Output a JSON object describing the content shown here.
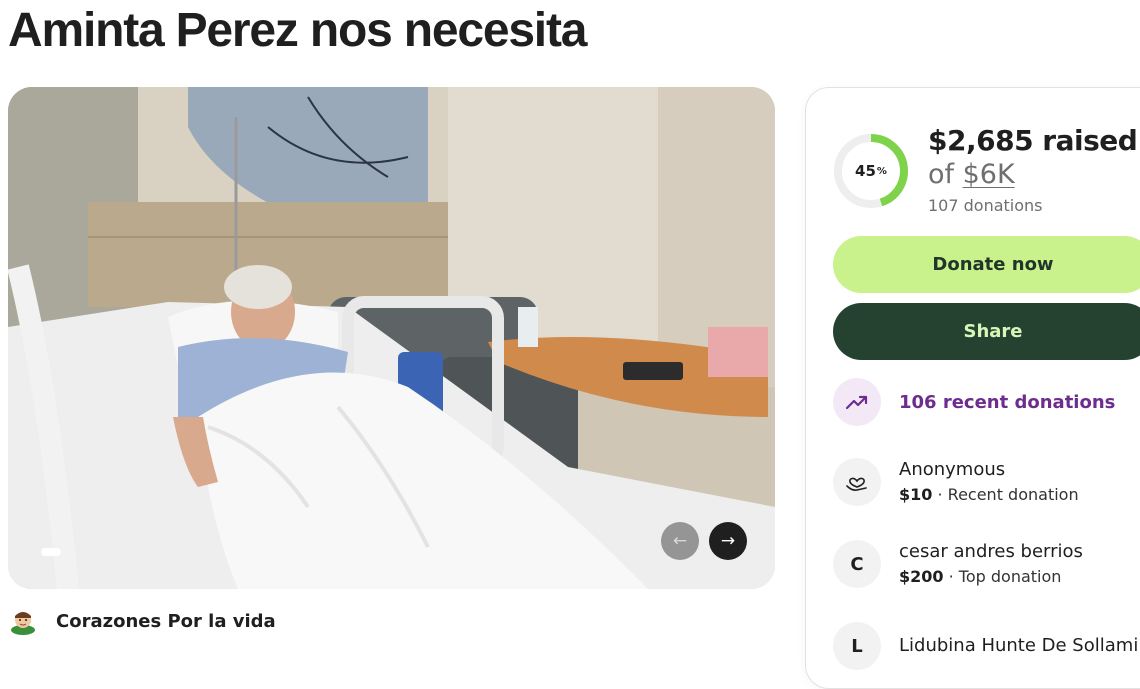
{
  "page": {
    "title": "Aminta Perez nos necesita"
  },
  "gallery": {
    "image_alt": "hospital-patient-photo"
  },
  "organizer": {
    "name": "Corazones Por la vida"
  },
  "donation_card": {
    "progress_percent": 45,
    "progress_label": "45",
    "progress_suffix": "%",
    "raised_text": "$2,685 raised",
    "goal_prefix": "of ",
    "goal_amount": "$6K",
    "donations_count_text": "107 donations",
    "donate_button": "Donate now",
    "share_button": "Share",
    "recent_donations_text": "106 recent donations",
    "donors": [
      {
        "name": "Anonymous",
        "amount": "$10",
        "sep": " · ",
        "type": "Recent donation",
        "icon": "heart-hand-icon"
      },
      {
        "name": "cesar andres berrios",
        "amount": "$200",
        "sep": " · ",
        "type": "Top donation",
        "initial": "C"
      },
      {
        "name": "Lidubina Hunte De Sollami",
        "initial": "L"
      }
    ]
  },
  "colors": {
    "accent_green": "#c9f28c",
    "dark_green": "#254231",
    "progress_green": "#7fd34a",
    "purple": "#6d2d8f"
  }
}
